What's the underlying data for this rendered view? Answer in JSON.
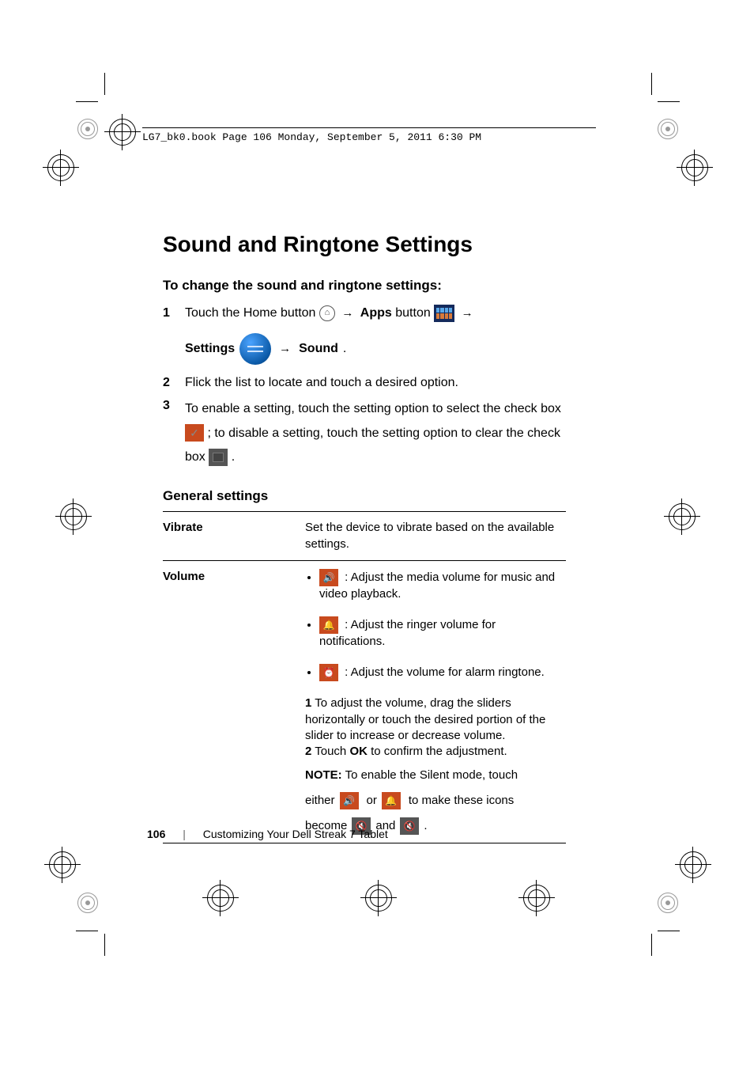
{
  "header": {
    "text": "LG7_bk0.book  Page 106  Monday, September 5, 2011  6:30 PM"
  },
  "title": "Sound and Ringtone Settings",
  "subheading": "To change the sound and ringtone settings:",
  "steps": {
    "s1": {
      "num": "1",
      "part1": "Touch the Home button ",
      "apps_label": "Apps",
      "button_word": " button ",
      "settings_label": "Settings",
      "sound_label": "Sound"
    },
    "s2": {
      "num": "2",
      "text": "Flick the list to locate and touch a desired option."
    },
    "s3": {
      "num": "3",
      "part1": "To enable a setting, touch the setting option to select the check box ",
      "part2": "; to disable a setting, touch the setting option to clear the check box ",
      "part3": "."
    }
  },
  "section_heading": "General settings",
  "table": {
    "vibrate": {
      "label": "Vibrate",
      "text": "Set the device to vibrate based on the available settings."
    },
    "volume": {
      "label": "Volume",
      "media": ": Adjust the media volume for music and video playback.",
      "ringer": ": Adjust the ringer volume for notifications.",
      "alarm": ": Adjust the volume for alarm ringtone.",
      "inner1_num": "1",
      "inner1": " To adjust the volume, drag the sliders horizontally or touch the desired portion of the slider to increase or decrease volume.",
      "inner2_num": "2",
      "inner2_a": " Touch ",
      "inner2_ok": "OK",
      "inner2_b": " to confirm the adjustment.",
      "note_label": "NOTE:",
      "note_text": " To enable the Silent mode, touch",
      "note_either": "either",
      "note_or": "or",
      "note_make": "to make these icons",
      "note_become": "become",
      "note_and": "and",
      "note_period": "."
    }
  },
  "footer": {
    "page": "106",
    "chapter": "Customizing Your Dell Streak 7 Tablet"
  },
  "arrow_glyph": "→",
  "home_glyph": "⌂",
  "check_glyph": "✓",
  "speaker_glyph": "🔊",
  "bell_glyph": "🔔",
  "clock_glyph": "⏰",
  "mute_glyph": "🔇"
}
